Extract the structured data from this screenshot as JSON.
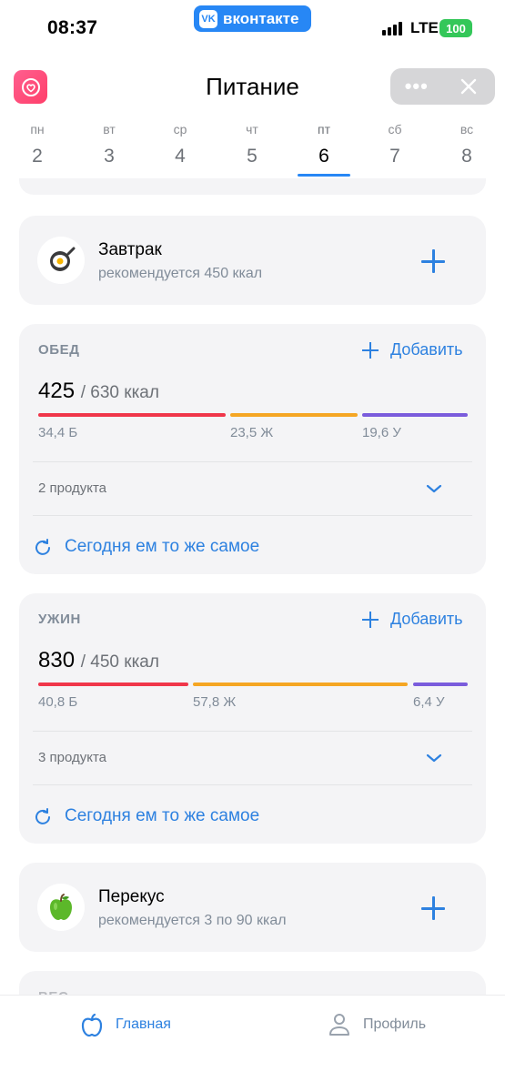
{
  "status_bar": {
    "time": "08:37",
    "app_pill": "вконтакте",
    "app_pill_logo": "VK",
    "network": "LTE",
    "battery": "100"
  },
  "header": {
    "title": "Питание",
    "menu_icon": "more-dots-icon",
    "close_icon": "close-icon"
  },
  "week": {
    "days": [
      {
        "name": "пн",
        "num": "2"
      },
      {
        "name": "вт",
        "num": "3"
      },
      {
        "name": "ср",
        "num": "4"
      },
      {
        "name": "чт",
        "num": "5"
      },
      {
        "name": "пт",
        "num": "6"
      },
      {
        "name": "сб",
        "num": "7"
      },
      {
        "name": "вс",
        "num": "8"
      }
    ],
    "selected_index": 4
  },
  "breakfast": {
    "title": "Завтрак",
    "subtitle": "рекомендуется 450 ккал",
    "icon": "fried-egg-icon"
  },
  "lunch": {
    "label": "ОБЕД",
    "add": "Добавить",
    "eaten": "425",
    "target": "/ 630 ккал",
    "protein": "34,4 Б",
    "fat": "23,5 Ж",
    "carbs": "19,6 У",
    "products": "2 продукта",
    "repeat": "Сегодня ем то же самое"
  },
  "dinner": {
    "label": "УЖИН",
    "add": "Добавить",
    "eaten": "830",
    "target": "/ 450 ккал",
    "protein": "40,8 Б",
    "fat": "57,8 Ж",
    "carbs": "6,4 У",
    "products": "3 продукта",
    "repeat": "Сегодня ем то же самое"
  },
  "snack": {
    "title": "Перекус",
    "subtitle": "рекомендуется 3 по 90 ккал",
    "icon": "green-apple-icon"
  },
  "next_section_label": "ВЕС",
  "tabbar": {
    "home": "Главная",
    "profile": "Профиль"
  },
  "colors": {
    "accent": "#2d81e0",
    "protein": "#f0364a",
    "fat": "#f5a623",
    "carbs": "#7a5cdc",
    "card": "#f4f4f6"
  }
}
